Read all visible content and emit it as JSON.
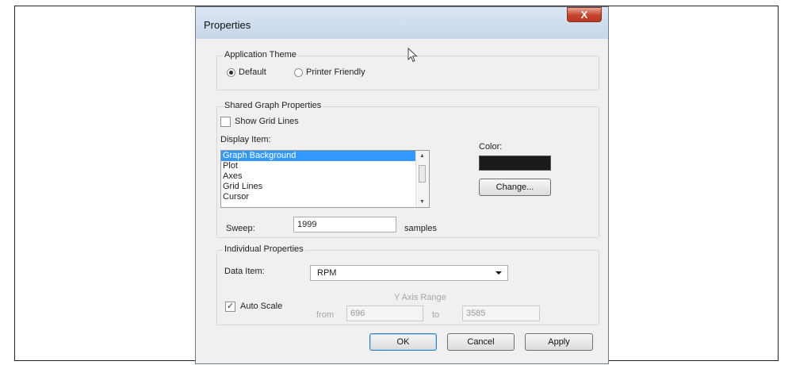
{
  "dialog": {
    "title": "Properties",
    "close_glyph": "X"
  },
  "theme": {
    "group_label": "Application Theme",
    "options": [
      "Default",
      "Printer Friendly"
    ],
    "selected": "Default"
  },
  "shared": {
    "group_label": "Shared Graph Properties",
    "show_grid_lines_label": "Show Grid Lines",
    "show_grid_lines_checked": false,
    "display_item_label": "Display Item:",
    "display_items": [
      "Graph Background",
      "Plot",
      "Axes",
      "Grid Lines",
      "Cursor"
    ],
    "selected_item": "Graph Background",
    "color_label": "Color:",
    "color_value": "#1a1a1a",
    "change_label": "Change...",
    "sweep_label": "Sweep:",
    "sweep_value": "1999",
    "sweep_unit": "samples"
  },
  "individual": {
    "group_label": "Individual Properties",
    "data_item_label": "Data Item:",
    "data_item_value": "RPM",
    "auto_scale_label": "Auto Scale",
    "auto_scale_checked": true,
    "check_glyph": "✓",
    "y_axis_range_label": "Y Axis Range",
    "from_label": "from",
    "from_value": "696",
    "to_label": "to",
    "to_value": "3585"
  },
  "buttons": {
    "ok": "OK",
    "cancel": "Cancel",
    "apply": "Apply"
  },
  "icons": {
    "cursor": "mouse-pointer-icon",
    "close": "close-icon",
    "dropdown": "chevron-down-icon"
  }
}
